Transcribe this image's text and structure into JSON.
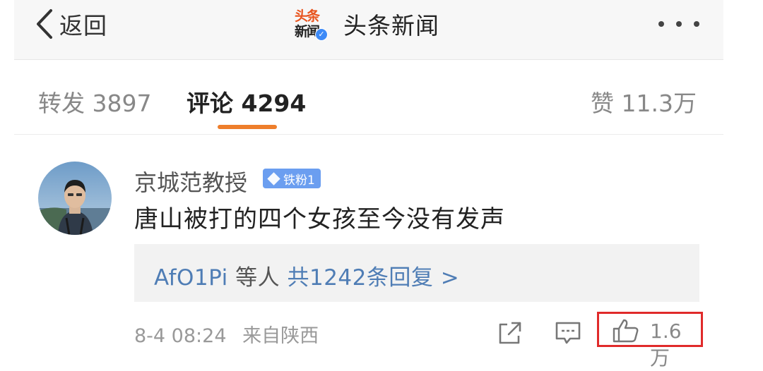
{
  "nav": {
    "back_label": "返回",
    "logo_line1": "头条",
    "logo_line2": "新闻",
    "title": "头条新闻",
    "icons": {
      "back": "chevron-left-icon",
      "more": "more-dots-icon",
      "verified": "verified-badge-icon"
    }
  },
  "tabs": {
    "repost": "转发 3897",
    "comment": "评论 4294",
    "like": "赞 11.3万"
  },
  "comment": {
    "username": "京城范教授",
    "badge": "铁粉1",
    "text": "唐山被打的四个女孩至今没有发声",
    "reply_users": "AfO1Pi",
    "reply_mid": "等人",
    "reply_count": "共1242条回复 >",
    "time": "8-4 08:24",
    "source": "来自陕西",
    "like_count": "1.6万",
    "icons": {
      "share": "share-icon",
      "comment": "comment-icon",
      "like": "thumbs-up-icon",
      "badge": "diamond-icon"
    }
  },
  "colors": {
    "accent_tab": "#ee7e2b",
    "link_blue": "#4f7db5",
    "badge_blue": "#6b9ef0",
    "highlight_red": "#e02a2a"
  }
}
